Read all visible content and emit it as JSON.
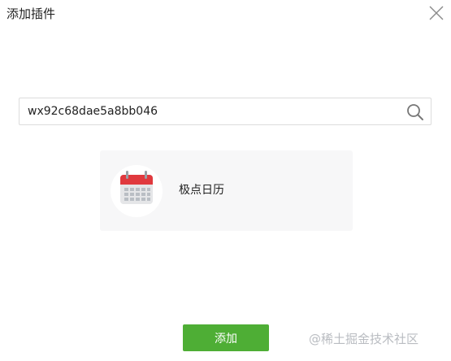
{
  "dialog": {
    "title": "添加插件",
    "close_icon": "close-icon"
  },
  "search": {
    "value": "wx92c68dae5a8bb046",
    "icon": "search-icon"
  },
  "result": {
    "icon": "calendar-icon",
    "name": "极点日历"
  },
  "footer": {
    "add_label": "添加"
  },
  "watermark": "@稀土掘金技术社区",
  "colors": {
    "accent": "#4eae35",
    "calendar_red": "#e0393e",
    "card_bg": "#f7f7f8"
  }
}
